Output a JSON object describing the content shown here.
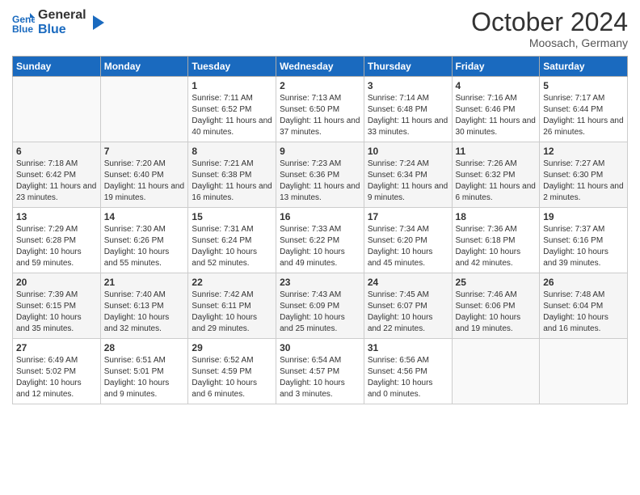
{
  "header": {
    "logo_line1": "General",
    "logo_line2": "Blue",
    "month_title": "October 2024",
    "subtitle": "Moosach, Germany"
  },
  "days_of_week": [
    "Sunday",
    "Monday",
    "Tuesday",
    "Wednesday",
    "Thursday",
    "Friday",
    "Saturday"
  ],
  "weeks": [
    [
      {
        "day": "",
        "info": ""
      },
      {
        "day": "",
        "info": ""
      },
      {
        "day": "1",
        "info": "Sunrise: 7:11 AM\nSunset: 6:52 PM\nDaylight: 11 hours and 40 minutes."
      },
      {
        "day": "2",
        "info": "Sunrise: 7:13 AM\nSunset: 6:50 PM\nDaylight: 11 hours and 37 minutes."
      },
      {
        "day": "3",
        "info": "Sunrise: 7:14 AM\nSunset: 6:48 PM\nDaylight: 11 hours and 33 minutes."
      },
      {
        "day": "4",
        "info": "Sunrise: 7:16 AM\nSunset: 6:46 PM\nDaylight: 11 hours and 30 minutes."
      },
      {
        "day": "5",
        "info": "Sunrise: 7:17 AM\nSunset: 6:44 PM\nDaylight: 11 hours and 26 minutes."
      }
    ],
    [
      {
        "day": "6",
        "info": "Sunrise: 7:18 AM\nSunset: 6:42 PM\nDaylight: 11 hours and 23 minutes."
      },
      {
        "day": "7",
        "info": "Sunrise: 7:20 AM\nSunset: 6:40 PM\nDaylight: 11 hours and 19 minutes."
      },
      {
        "day": "8",
        "info": "Sunrise: 7:21 AM\nSunset: 6:38 PM\nDaylight: 11 hours and 16 minutes."
      },
      {
        "day": "9",
        "info": "Sunrise: 7:23 AM\nSunset: 6:36 PM\nDaylight: 11 hours and 13 minutes."
      },
      {
        "day": "10",
        "info": "Sunrise: 7:24 AM\nSunset: 6:34 PM\nDaylight: 11 hours and 9 minutes."
      },
      {
        "day": "11",
        "info": "Sunrise: 7:26 AM\nSunset: 6:32 PM\nDaylight: 11 hours and 6 minutes."
      },
      {
        "day": "12",
        "info": "Sunrise: 7:27 AM\nSunset: 6:30 PM\nDaylight: 11 hours and 2 minutes."
      }
    ],
    [
      {
        "day": "13",
        "info": "Sunrise: 7:29 AM\nSunset: 6:28 PM\nDaylight: 10 hours and 59 minutes."
      },
      {
        "day": "14",
        "info": "Sunrise: 7:30 AM\nSunset: 6:26 PM\nDaylight: 10 hours and 55 minutes."
      },
      {
        "day": "15",
        "info": "Sunrise: 7:31 AM\nSunset: 6:24 PM\nDaylight: 10 hours and 52 minutes."
      },
      {
        "day": "16",
        "info": "Sunrise: 7:33 AM\nSunset: 6:22 PM\nDaylight: 10 hours and 49 minutes."
      },
      {
        "day": "17",
        "info": "Sunrise: 7:34 AM\nSunset: 6:20 PM\nDaylight: 10 hours and 45 minutes."
      },
      {
        "day": "18",
        "info": "Sunrise: 7:36 AM\nSunset: 6:18 PM\nDaylight: 10 hours and 42 minutes."
      },
      {
        "day": "19",
        "info": "Sunrise: 7:37 AM\nSunset: 6:16 PM\nDaylight: 10 hours and 39 minutes."
      }
    ],
    [
      {
        "day": "20",
        "info": "Sunrise: 7:39 AM\nSunset: 6:15 PM\nDaylight: 10 hours and 35 minutes."
      },
      {
        "day": "21",
        "info": "Sunrise: 7:40 AM\nSunset: 6:13 PM\nDaylight: 10 hours and 32 minutes."
      },
      {
        "day": "22",
        "info": "Sunrise: 7:42 AM\nSunset: 6:11 PM\nDaylight: 10 hours and 29 minutes."
      },
      {
        "day": "23",
        "info": "Sunrise: 7:43 AM\nSunset: 6:09 PM\nDaylight: 10 hours and 25 minutes."
      },
      {
        "day": "24",
        "info": "Sunrise: 7:45 AM\nSunset: 6:07 PM\nDaylight: 10 hours and 22 minutes."
      },
      {
        "day": "25",
        "info": "Sunrise: 7:46 AM\nSunset: 6:06 PM\nDaylight: 10 hours and 19 minutes."
      },
      {
        "day": "26",
        "info": "Sunrise: 7:48 AM\nSunset: 6:04 PM\nDaylight: 10 hours and 16 minutes."
      }
    ],
    [
      {
        "day": "27",
        "info": "Sunrise: 6:49 AM\nSunset: 5:02 PM\nDaylight: 10 hours and 12 minutes."
      },
      {
        "day": "28",
        "info": "Sunrise: 6:51 AM\nSunset: 5:01 PM\nDaylight: 10 hours and 9 minutes."
      },
      {
        "day": "29",
        "info": "Sunrise: 6:52 AM\nSunset: 4:59 PM\nDaylight: 10 hours and 6 minutes."
      },
      {
        "day": "30",
        "info": "Sunrise: 6:54 AM\nSunset: 4:57 PM\nDaylight: 10 hours and 3 minutes."
      },
      {
        "day": "31",
        "info": "Sunrise: 6:56 AM\nSunset: 4:56 PM\nDaylight: 10 hours and 0 minutes."
      },
      {
        "day": "",
        "info": ""
      },
      {
        "day": "",
        "info": ""
      }
    ]
  ]
}
